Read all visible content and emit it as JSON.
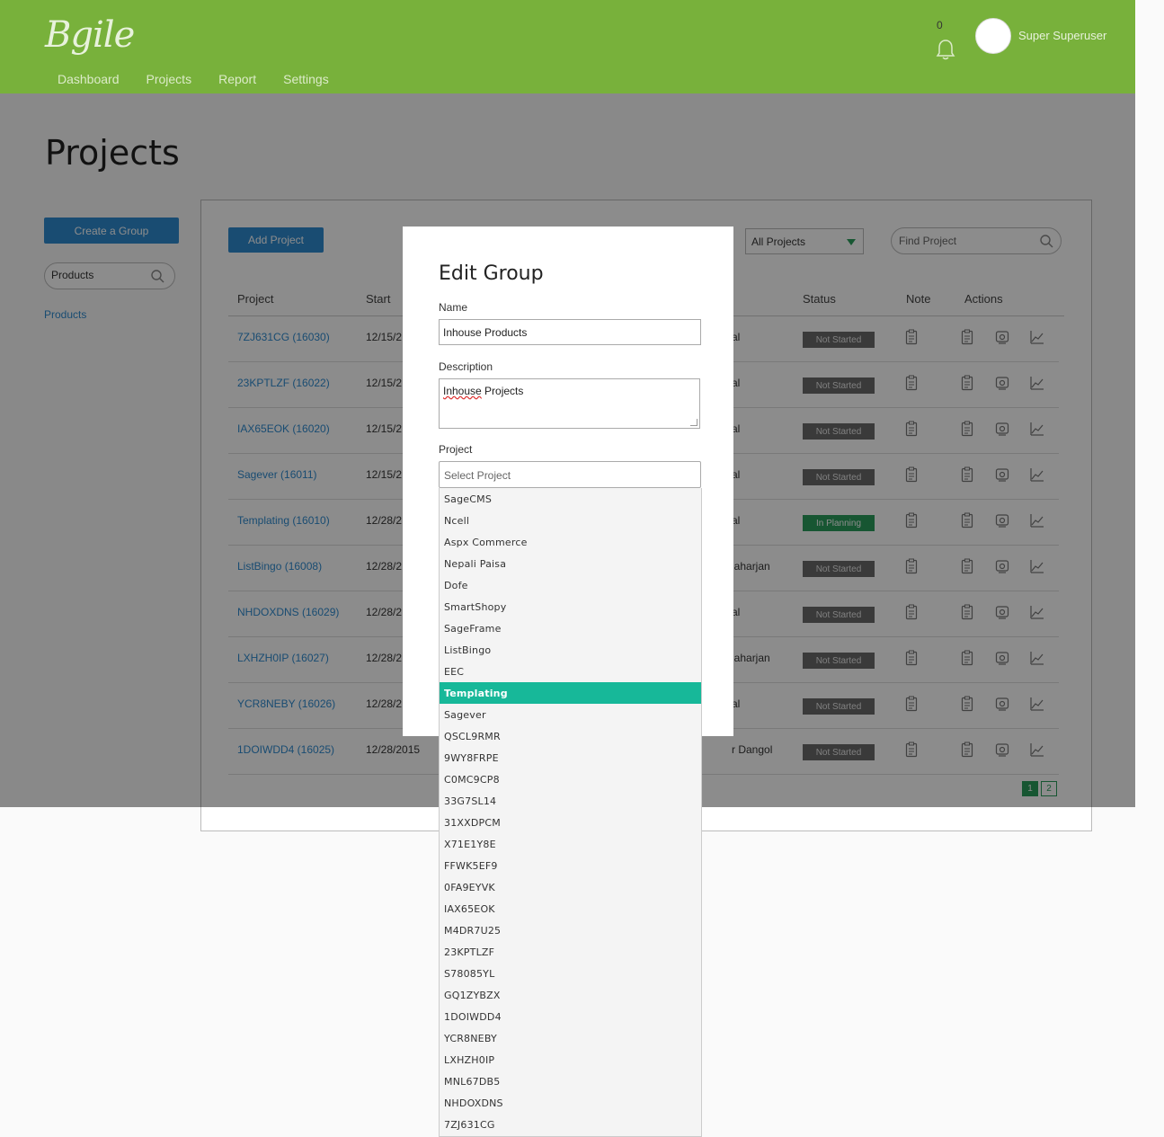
{
  "app": {
    "logo": "Bgile",
    "nav": [
      "Dashboard",
      "Projects",
      "Report",
      "Settings"
    ],
    "notifications_count": "0",
    "user_name": "Super Superuser"
  },
  "page": {
    "title": "Projects",
    "create_group_label": "Create a Group",
    "group_search_value": "Products",
    "group_link": "Products",
    "add_project_label": "Add Project",
    "filter_selected": "All Projects",
    "find_placeholder": "Find Project"
  },
  "table": {
    "headers": [
      "Project",
      "Start",
      "Status",
      "Note",
      "Actions"
    ],
    "rows": [
      {
        "name": "7ZJ631CG (16030)",
        "start": "12/15/2",
        "owner": "al",
        "status": "Not Started"
      },
      {
        "name": "23KPTLZF (16022)",
        "start": "12/15/2",
        "owner": "al",
        "status": "Not Started"
      },
      {
        "name": "IAX65EOK (16020)",
        "start": "12/15/2",
        "owner": "al",
        "status": "Not Started"
      },
      {
        "name": "Sagever (16011)",
        "start": "12/15/2",
        "owner": "al",
        "status": "Not Started"
      },
      {
        "name": "Templating (16010)",
        "start": "12/28/2",
        "owner": "al",
        "status": "In Planning"
      },
      {
        "name": "ListBingo (16008)",
        "start": "12/28/2",
        "owner": "laharjan",
        "status": "Not Started"
      },
      {
        "name": "NHDOXDNS (16029)",
        "start": "12/28/2",
        "owner": "al",
        "status": "Not Started"
      },
      {
        "name": "LXHZH0IP (16027)",
        "start": "12/28/2",
        "owner": "laharjan",
        "status": "Not Started"
      },
      {
        "name": "YCR8NEBY (16026)",
        "start": "12/28/2",
        "owner": "al",
        "status": "Not Started"
      },
      {
        "name": "1DOIWDD4 (16025)",
        "start": "12/28/2015",
        "owner": "r Dangol",
        "status": "Not Started"
      }
    ],
    "pages": [
      "1",
      "2"
    ],
    "status_colors": {
      "not_started": "#6b6b6b",
      "in_planning": "#2a9d5c"
    }
  },
  "modal": {
    "title": "Edit Group",
    "name_label": "Name",
    "name_value": "Inhouse Products",
    "description_label": "Description",
    "description_word1": "Inhouse",
    "description_word2": " Projects",
    "project_label": "Project",
    "project_placeholder": "Select Project",
    "project_options": [
      "SageCMS",
      "Ncell",
      "Aspx Commerce",
      "Nepali Paisa",
      "Dofe",
      "SmartShopy",
      "SageFrame",
      "ListBingo",
      "EEC",
      "Templating",
      "Sagever",
      "QSCL9RMR",
      "9WY8FRPE",
      "C0MC9CP8",
      "33G7SL14",
      "31XXDPCM",
      "X71E1Y8E",
      "FFWK5EF9",
      "0FA9EYVK",
      "IAX65EOK",
      "M4DR7U25",
      "23KPTLZF",
      "S78085YL",
      "GQ1ZYBZX",
      "1DOIWDD4",
      "YCR8NEBY",
      "LXHZH0IP",
      "MNL67DB5",
      "NHDOXDNS",
      "7ZJ631CG"
    ],
    "highlighted_option": "Templating"
  },
  "colors": {
    "header": "#78b13b",
    "primary": "#2f8bd0",
    "highlight": "#17b899"
  }
}
